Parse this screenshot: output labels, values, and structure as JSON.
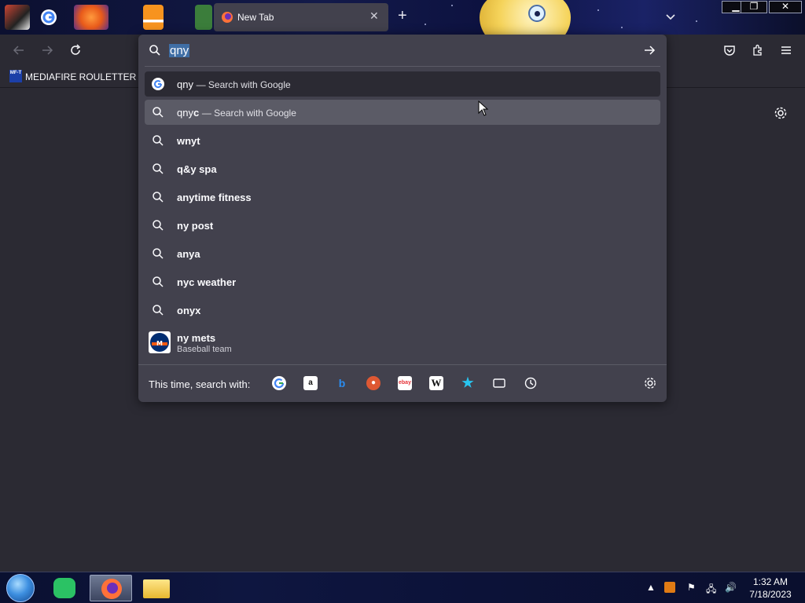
{
  "browser": {
    "active_tab_title": "New Tab",
    "bookmarks": [
      {
        "label": "MEDIAFIRE ROULETTER",
        "icon": "MF-T"
      }
    ]
  },
  "urlbar": {
    "typed_text": "qny",
    "suggestions": [
      {
        "icon": "google-icon",
        "query": "qny",
        "action": "— Search with Google",
        "selected": true
      },
      {
        "icon": "search-icon",
        "query_prefix": "qny",
        "query_completion": "c",
        "action": "— Search with Google",
        "hovered": true
      },
      {
        "icon": "search-icon",
        "query": "wnyt"
      },
      {
        "icon": "search-icon",
        "query": "q&y spa"
      },
      {
        "icon": "search-icon",
        "query": "anytime fitness"
      },
      {
        "icon": "search-icon",
        "query": "ny post"
      },
      {
        "icon": "search-icon",
        "query": "anya"
      },
      {
        "icon": "search-icon",
        "query": "nyc weather"
      },
      {
        "icon": "search-icon",
        "query": "onyx"
      },
      {
        "icon": "mets-logo",
        "query": "ny mets",
        "subtitle": "Baseball team"
      }
    ],
    "footer_label": "This time, search with:",
    "engines": [
      "google",
      "amazon",
      "bing",
      "duckduckgo",
      "ebay",
      "wikipedia",
      "bookmarks",
      "tabs",
      "history"
    ]
  },
  "taskbar": {
    "clock_time": "1:32 AM",
    "clock_date": "7/18/2023"
  },
  "colors": {
    "panel": "#42414d",
    "page": "#2b2a33",
    "selection": "#3f6ea5",
    "hover": "#5b5b66"
  }
}
